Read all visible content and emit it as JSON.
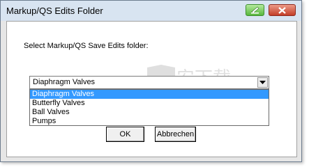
{
  "window": {
    "title": "Markup/QS Edits Folder",
    "minimize_icon": "minimize-icon",
    "close_icon": "close-icon"
  },
  "prompt_label": "Select Markup/QS Save Edits folder:",
  "folder_select": {
    "selected_value": "Diaphragm Valves",
    "arrow_icon": "chevron-down-icon",
    "options": [
      "Diaphragm Valves",
      "Butterfly Valves",
      "Ball Valves",
      "Pumps"
    ],
    "highlighted_index": 0
  },
  "buttons": {
    "ok_label": "OK",
    "cancel_label": "Abbrechen"
  },
  "watermark": {
    "logo_text": "安下载",
    "url_text": "anxz.com",
    "icon": "shield-logo-icon"
  },
  "colors": {
    "titlebar": "#d8e4f1",
    "selection": "#3399ff",
    "minimize_button": "#58b73c",
    "close_button": "#c33e28"
  }
}
